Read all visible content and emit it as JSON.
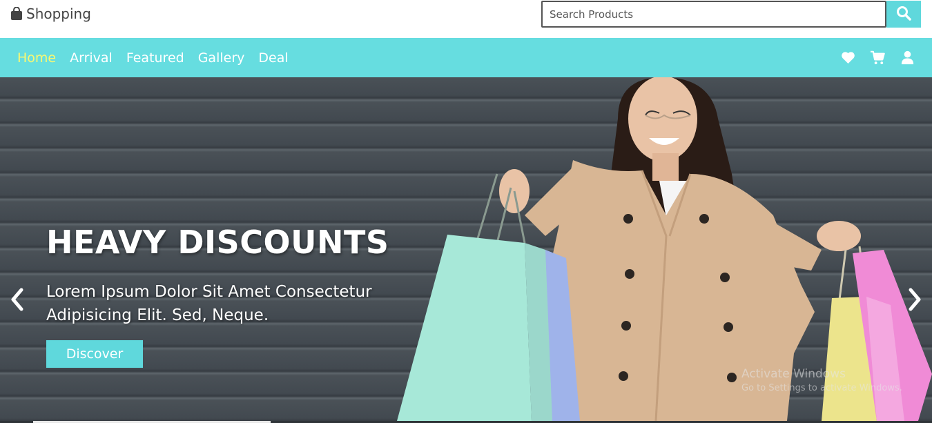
{
  "header": {
    "logo_text": "Shopping",
    "logo_icon": "shopping-bag-icon",
    "search_placeholder": "Search Products",
    "search_icon": "search-icon"
  },
  "nav": {
    "links": [
      {
        "label": "Home",
        "active": true
      },
      {
        "label": "Arrival",
        "active": false
      },
      {
        "label": "Featured",
        "active": false
      },
      {
        "label": "Gallery",
        "active": false
      },
      {
        "label": "Deal",
        "active": false
      }
    ],
    "icons": [
      "heart-icon",
      "cart-icon",
      "user-icon"
    ]
  },
  "hero": {
    "title": "HEAVY DISCOUNTS",
    "subtitle": "Lorem Ipsum Dolor Sit Amet Consectetur Adipisicing Elit. Sed, Neque.",
    "button_label": "Discover",
    "prev_icon": "chevron-left-icon",
    "next_icon": "chevron-right-icon"
  },
  "watermark": {
    "title": "Activate Windows",
    "subtitle": "Go to Settings to activate Windows."
  },
  "colors": {
    "accent": "#66dde0",
    "active_link": "#f9f871",
    "button": "#5fd8dc"
  }
}
